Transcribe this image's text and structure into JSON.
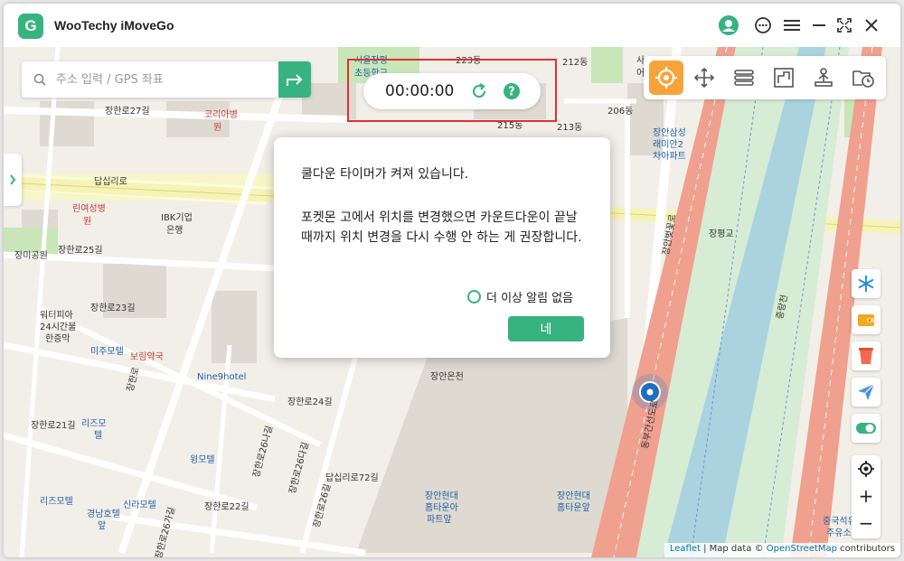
{
  "app": {
    "title": "WooTechy iMoveGo",
    "logo_letter": "G",
    "accent": "#36b37e"
  },
  "search": {
    "placeholder": "주소 입력 / GPS 좌표"
  },
  "timer": {
    "time": "00:00:00"
  },
  "map_labels": {
    "l1": "장한로27길",
    "l2": "코리아병",
    "l2b": "원",
    "l3": "답십리로",
    "l4": "린여성병",
    "l4b": "원",
    "l5": "IBK기업",
    "l5b": "은행",
    "l6": "장한로25길",
    "l7": "장미공원",
    "l8": "장한로23길",
    "l9": "워터피아",
    "l9b": "24시간불",
    "l9c": "한증막",
    "l10": "미주모텔",
    "l11": "보림약국",
    "l12": "Nine9hotel",
    "l13": "장안온천",
    "l14": "장한로24길",
    "l15": "장한로21길",
    "l16": "리즈모",
    "l16b": "텔",
    "l17": "윙모텔",
    "l18": "답십리로72길",
    "l19": "리즈모텔",
    "l20": "신라모텔",
    "l21": "경남호텔",
    "l21b": "앞",
    "l22": "장한로22길",
    "l23": "장안현대",
    "l23b": "홈타운아",
    "l23c": "파트앞",
    "l24": "장안현대",
    "l24b": "홈타운앞",
    "l25": "장평교",
    "l26": "장안삼성",
    "l26b": "래미안2",
    "l26c": "차아파트",
    "l27": "212동",
    "l28": "213동",
    "l29": "206동",
    "l30": "215동",
    "l31": "223동",
    "l32": "시울장평",
    "l33": "초등학교",
    "l34": "중국석유",
    "l34b": "주유소",
    "l35": "장한로",
    "l36": "장한로26나길",
    "l37": "장한로26다길",
    "l38": "장한로26길",
    "l39": "장한로26가길",
    "l40": "장안벚꽃로",
    "l41": "동부간선도로",
    "l42": "중랑천",
    "l43": "사",
    "l43b": "어"
  },
  "dialog": {
    "title": "쿨다운 타이머가 켜져 있습니다.",
    "body": "포켓몬 고에서 위치를 변경했으면 카운트다운이 끝날 때까지 위치 변경을 다시 수행 안 하는 게 권장합니다.",
    "dont_show": "더 이상 알림 없음",
    "ok": "네"
  },
  "attribution": {
    "leaflet": "Leaflet",
    "sep": " | Map data © ",
    "osm": "OpenStreetMap",
    "contrib": " contributors"
  },
  "zoom": {
    "in": "+",
    "out": "−"
  }
}
